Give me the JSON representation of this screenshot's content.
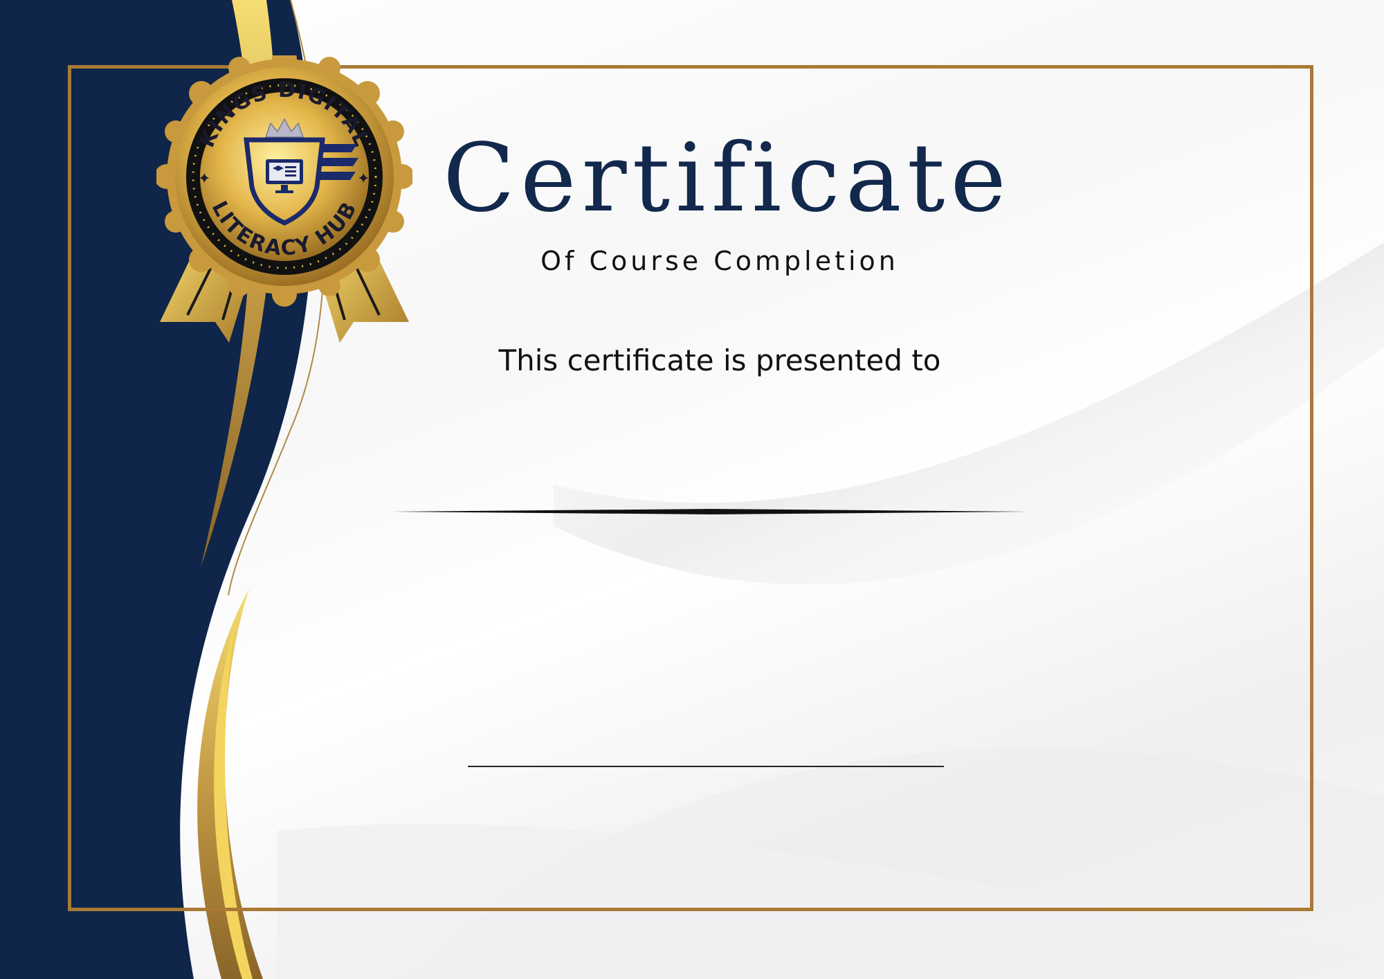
{
  "certificate": {
    "title": "Certificate",
    "subtitle": "Of Course Completion",
    "presented_text": "This certificate is presented to"
  },
  "seal": {
    "top_text": "KINGS DIGITAL",
    "bottom_text": "LITERACY HUB",
    "icon": "crown-shield-computer-icon"
  },
  "colors": {
    "navy": "#0f2549",
    "gold": "#a87a35",
    "gold_light": "#f3d45e",
    "text_dark": "#111111"
  }
}
